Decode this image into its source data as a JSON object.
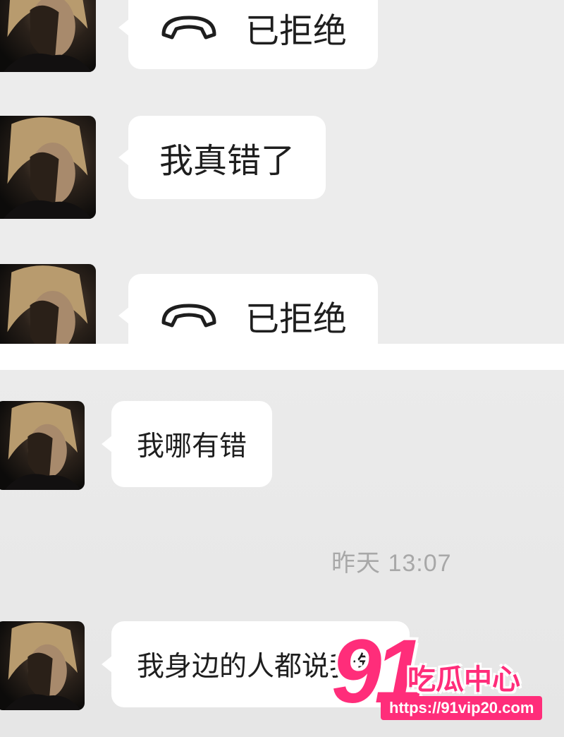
{
  "messages": [
    {
      "type": "call",
      "text": "已拒绝",
      "icon": "phone-declined-icon"
    },
    {
      "type": "text",
      "text": "我真错了"
    },
    {
      "type": "call",
      "text": "已拒绝",
      "icon": "phone-declined-icon"
    },
    {
      "type": "text",
      "text": "我哪有错"
    },
    {
      "type": "text",
      "text": "我身边的人都说我错"
    }
  ],
  "timestamp": "昨天 13:07",
  "watermark": {
    "number": "91",
    "title": "吃瓜中心",
    "url": "https://91vip20.com"
  },
  "colors": {
    "chat_background": "#ececec",
    "bubble": "#ffffff",
    "text": "#1e1e1e",
    "timestamp": "#a8a8a8",
    "watermark": "#ff2d7a"
  }
}
